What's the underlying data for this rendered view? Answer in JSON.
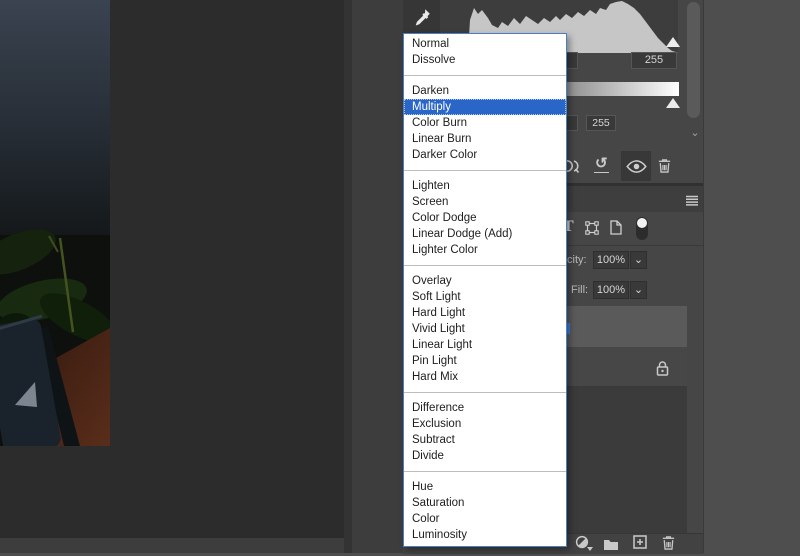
{
  "blend_mode_dropdown": {
    "selected_item": "Multiply",
    "highlight_color": "#2a65c8",
    "border_color": "#4a7fc1",
    "groups": [
      {
        "items": [
          "Normal",
          "Dissolve"
        ]
      },
      {
        "items": [
          "Darken",
          "Multiply",
          "Color Burn",
          "Linear Burn",
          "Darker Color"
        ]
      },
      {
        "items": [
          "Lighten",
          "Screen",
          "Color Dodge",
          "Linear Dodge (Add)",
          "Lighter Color"
        ]
      },
      {
        "items": [
          "Overlay",
          "Soft Light",
          "Hard Light",
          "Vivid Light",
          "Linear Light",
          "Pin Light",
          "Hard Mix"
        ]
      },
      {
        "items": [
          "Difference",
          "Exclusion",
          "Subtract",
          "Divide"
        ]
      },
      {
        "items": [
          "Hue",
          "Saturation",
          "Color",
          "Luminosity"
        ]
      }
    ]
  },
  "properties_panel": {
    "input_white_level": "255",
    "output_white_level": "255",
    "reset_glyph": "↺",
    "scroll_chevron_glyph": "⌄"
  },
  "layers_panel": {
    "opacity_label_visible": "city:",
    "opacity_value": "100%",
    "fill_label": "Fill:",
    "fill_value": "100%",
    "chevron_glyph": "⌄",
    "filter_type_glyph": "T"
  },
  "icons": {
    "eyedropper": "white-point-eyedropper",
    "clip": "clip-to-layer",
    "reset": "reset-adjustment",
    "eye": "toggle-visibility",
    "trash_properties": "delete-adjustment",
    "panel_menu": "layers-panel-menu",
    "filter_shape": "filter-shape-layers",
    "filter_smart_object": "filter-smart-objects",
    "filter_toggle": "layer-filtering-toggle",
    "lock": "layer-locked",
    "adjustment": "new-adjustment-layer",
    "group": "new-group",
    "new_layer": "new-layer",
    "trash_layers": "delete-layer"
  },
  "colors": {
    "panel_bg": "#464646",
    "canvas_bg": "#2c2c2c",
    "selection_blue": "#2a65c8",
    "selected_row": "#5a5a5a",
    "outside_bg": "#4e4e4e"
  }
}
